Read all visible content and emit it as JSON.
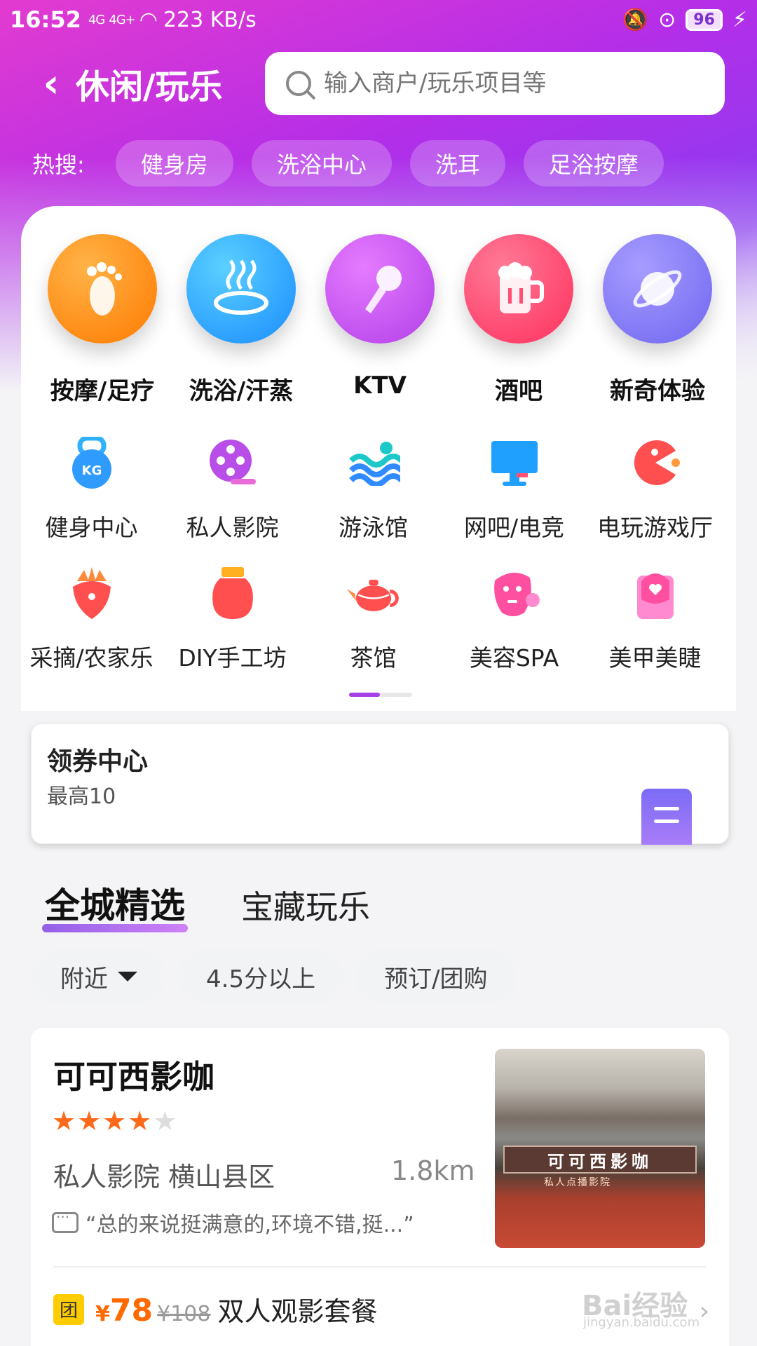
{
  "status_bar": {
    "time": "16:52",
    "signal1": "4G",
    "signal2": "4G+",
    "speed": "223 KB/s",
    "battery": "96"
  },
  "header": {
    "title": "休闲/玩乐",
    "search_placeholder": "输入商户/玩乐项目等"
  },
  "hot_search": {
    "label": "热搜:",
    "items": [
      "健身房",
      "洗浴中心",
      "洗耳",
      "足浴按摩"
    ]
  },
  "main_categories": [
    {
      "label": "按摩/足疗",
      "icon": "foot-icon",
      "color": "#ff7a00"
    },
    {
      "label": "洗浴/汗蒸",
      "icon": "steam-bath-icon",
      "color": "#1aa5ff"
    },
    {
      "label": "KTV",
      "icon": "microphone-icon",
      "color": "#c44af0"
    },
    {
      "label": "酒吧",
      "icon": "beer-mug-icon",
      "color": "#ff3f6c"
    },
    {
      "label": "新奇体验",
      "icon": "planet-icon",
      "color": "#7b72f4"
    }
  ],
  "sub_categories": [
    {
      "label": "健身中心",
      "icon": "kettlebell-icon"
    },
    {
      "label": "私人影院",
      "icon": "film-reel-icon"
    },
    {
      "label": "游泳馆",
      "icon": "swim-icon"
    },
    {
      "label": "网吧/电竞",
      "icon": "monitor-icon"
    },
    {
      "label": "电玩游戏厅",
      "icon": "pacman-icon"
    },
    {
      "label": "采摘/农家乐",
      "icon": "strawberry-icon"
    },
    {
      "label": "DIY手工坊",
      "icon": "jar-icon"
    },
    {
      "label": "茶馆",
      "icon": "teapot-icon"
    },
    {
      "label": "美容SPA",
      "icon": "face-mask-icon"
    },
    {
      "label": "美甲美睫",
      "icon": "nail-icon"
    }
  ],
  "coupon": {
    "title": "领券中心",
    "subtitle": "最高10"
  },
  "feed_tabs": [
    "全城精选",
    "宝藏玩乐"
  ],
  "filters": [
    "附近",
    "4.5分以上",
    "预订/团购"
  ],
  "shop": {
    "name": "可可西影咖",
    "rating": 4,
    "category_area": "私人影院 横山县区",
    "distance": "1.8km",
    "review": "“总的来说挺满意的,环境不错,挺...”",
    "photo_sign": "可可西影咖",
    "photo_sub": "私人点播影院",
    "deal": {
      "tag": "团",
      "currency": "¥",
      "price": "78",
      "old_price": "¥108",
      "name": "双人观影套餐"
    }
  },
  "watermark": {
    "main": "Bai经验",
    "sub": "jingyan.baidu.com"
  },
  "colors": {
    "accent": "#a540e8",
    "price": "#ff6a00",
    "star": "#ff6a1a"
  }
}
